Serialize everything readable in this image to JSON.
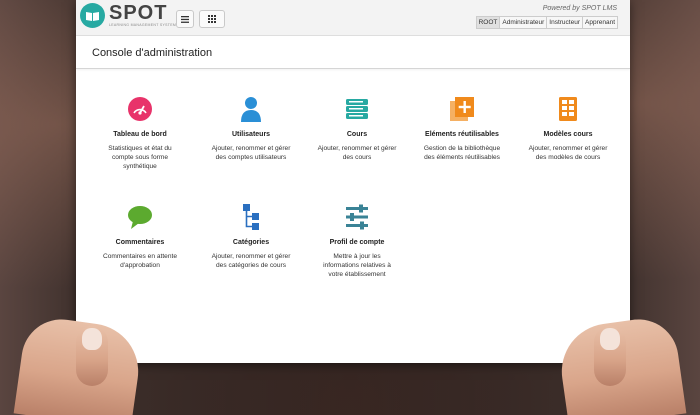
{
  "header": {
    "logo_title": "SPOT",
    "logo_subtitle": "LEARNING MANAGEMENT SYSTEM",
    "powered_by": "Powered by SPOT LMS",
    "roles": [
      "ROOT",
      "Administrateur",
      "Instructeur",
      "Apprenant"
    ],
    "active_role": "ROOT"
  },
  "page": {
    "title": "Console d'administration"
  },
  "tiles": [
    {
      "title": "Tableau de bord",
      "desc": "Statistiques et état du compte sous forme synthétique",
      "icon": "dashboard-gauge-icon",
      "color": "#e8336a"
    },
    {
      "title": "Utilisateurs",
      "desc": "Ajouter, renommer et gérer des comptes utilisateurs",
      "icon": "user-icon",
      "color": "#2a8fd6"
    },
    {
      "title": "Cours",
      "desc": "Ajouter, renommer et gérer des cours",
      "icon": "books-icon",
      "color": "#27a9a2"
    },
    {
      "title": "Eléments réutilisables",
      "desc": "Gestion de la bibliothèque des éléments réutilisables",
      "icon": "add-copy-icon",
      "color": "#f08a1c"
    },
    {
      "title": "Modèles cours",
      "desc": "Ajouter, renommer et gérer des modèles de cours",
      "icon": "template-grid-icon",
      "color": "#f08a1c"
    },
    {
      "title": "Commentaires",
      "desc": "Commentaires en attente d'approbation",
      "icon": "comment-bubble-icon",
      "color": "#5caa2f"
    },
    {
      "title": "Catégories",
      "desc": "Ajouter, renommer et gérer des catégories de cours",
      "icon": "hierarchy-icon",
      "color": "#2a6fc0"
    },
    {
      "title": "Profil de compte",
      "desc": "Mettre à jour les informations relatives à votre établissement",
      "icon": "settings-sliders-icon",
      "color": "#3a8396"
    }
  ]
}
